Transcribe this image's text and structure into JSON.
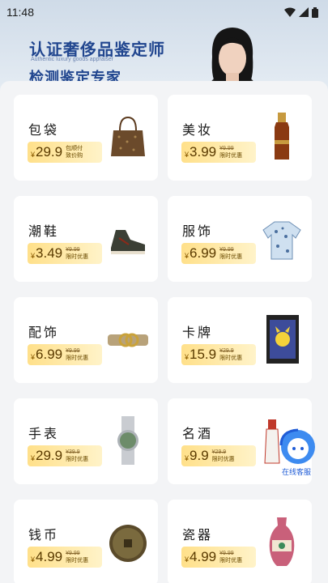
{
  "status": {
    "time": "11:48",
    "icons": [
      "wifi-icon",
      "cellular-signal-icon",
      "battery-icon"
    ]
  },
  "hero": {
    "title": "认证奢侈品鉴定师",
    "tagline": "Authentic luxury goods appraiser",
    "subtitle": "检测鉴定专家"
  },
  "cards": [
    {
      "name": "包袋",
      "price": "29.9",
      "yen": "¥",
      "note1": "包顺付",
      "note2": "致价购",
      "product_icon": "handbag-icon"
    },
    {
      "name": "美妆",
      "price": "3.99",
      "yen": "¥",
      "note1": "¥9.99",
      "note2": "限时优惠",
      "product_icon": "serum-bottle-icon"
    },
    {
      "name": "潮鞋",
      "price": "3.49",
      "yen": "¥",
      "note1": "¥9.99",
      "note2": "限时优惠",
      "product_icon": "sneaker-icon"
    },
    {
      "name": "服饰",
      "price": "6.99",
      "yen": "¥",
      "note1": "¥9.99",
      "note2": "限时优惠",
      "product_icon": "shirt-icon"
    },
    {
      "name": "配饰",
      "price": "6.99",
      "yen": "¥",
      "note1": "¥9.99",
      "note2": "限时优惠",
      "product_icon": "belt-icon"
    },
    {
      "name": "卡牌",
      "price": "15.9",
      "yen": "¥",
      "note1": "¥29.9",
      "note2": "限时优惠",
      "product_icon": "trading-card-icon"
    },
    {
      "name": "手表",
      "price": "29.9",
      "yen": "¥",
      "note1": "¥39.9",
      "note2": "限时优惠",
      "product_icon": "watch-icon"
    },
    {
      "name": "名酒",
      "price": "9.9",
      "yen": "¥",
      "note1": "¥29.9",
      "note2": "限时优惠",
      "product_icon": "liquor-bottle-icon"
    },
    {
      "name": "钱币",
      "price": "4.99",
      "yen": "¥",
      "note1": "¥9.99",
      "note2": "限时优惠",
      "product_icon": "coin-icon"
    },
    {
      "name": "瓷器",
      "price": "4.99",
      "yen": "¥",
      "note1": "¥9.99",
      "note2": "限时优惠",
      "product_icon": "vase-icon"
    }
  ],
  "fab": {
    "label": "在线客服",
    "icon": "customer-service-icon"
  },
  "colors": {
    "brand_blue": "#21468f",
    "price_pill": "#ffe08a",
    "fab_blue": "#1e5bd6"
  }
}
